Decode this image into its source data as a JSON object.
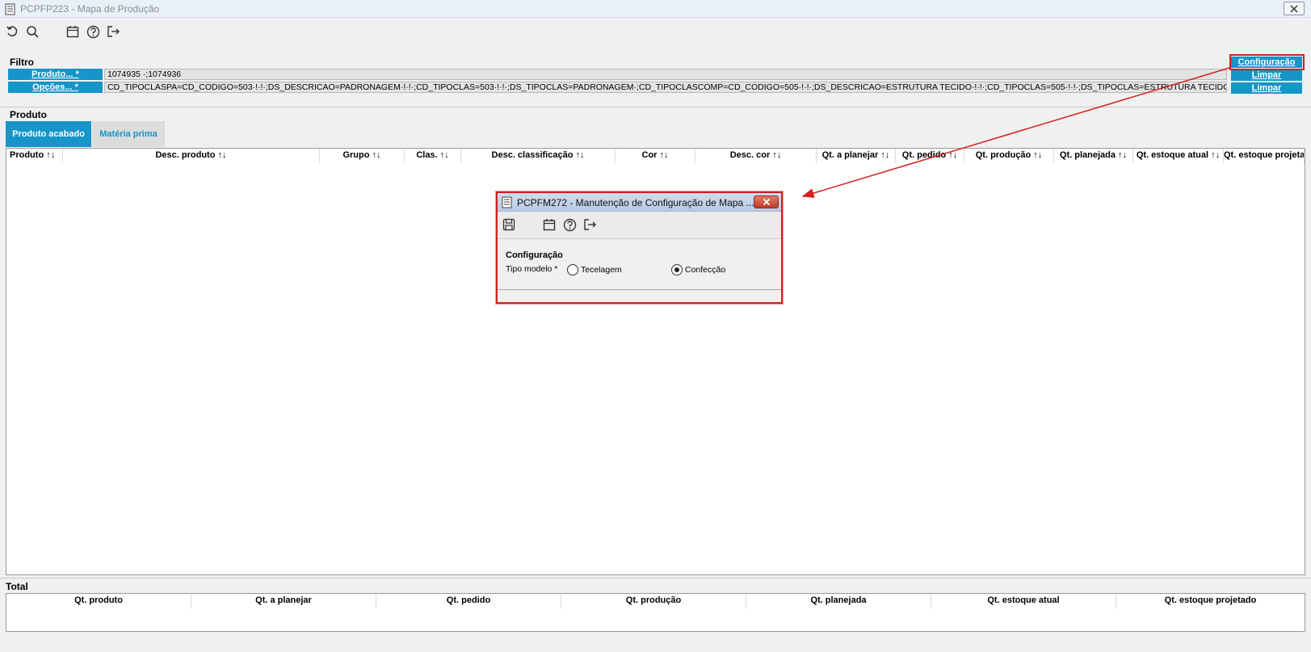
{
  "window": {
    "title": "PCPFP223 - Mapa de Produção"
  },
  "toolbar": {
    "icons": [
      "undo-icon",
      "search-icon",
      "calendar-icon",
      "help-icon",
      "exit-icon"
    ]
  },
  "filter": {
    "title": "Filtro",
    "produto_label": "Produto... *",
    "produto_value": "1074935 ·;1074936",
    "opcoes_label": "Opções... *",
    "opcoes_value": "CD_TIPOCLASPA=CD_CODIGO=503·!·!·;DS_DESCRICAO=PADRONAGEM·!·!·;CD_TIPOCLAS=503·!·!·;DS_TIPOCLAS=PADRONAGEM·;CD_TIPOCLASCOMP=CD_CODIGO=505·!·!·;DS_DESCRICAO=ESTRUTURA TECIDO·!·!·;CD_TIPOCLAS=505·!·!·;DS_TIPOCLAS=ESTRUTURA TECIDO·;CD_TIPOCLASCOMP",
    "config_button": "Configuração",
    "limpar1": "Limpar",
    "limpar2": "Limpar"
  },
  "produto": {
    "title": "Produto",
    "tabs": [
      "Produto acabado",
      "Matéria prima"
    ],
    "columns": [
      "Produto ↑↓",
      "Desc. produto ↑↓",
      "Grupo ↑↓",
      "Clas. ↑↓",
      "Desc. classificação ↑↓",
      "Cor ↑↓",
      "Desc. cor ↑↓",
      "Qt. a planejar ↑↓",
      "Qt. pedido ↑↓",
      "Qt. produção ↑↓",
      "Qt. planejada ↑↓",
      "Qt. estoque atual ↑↓",
      "Qt. estoque projetado ↑↓"
    ]
  },
  "total": {
    "title": "Total",
    "columns": [
      "Qt. produto",
      "Qt. a planejar",
      "Qt. pedido",
      "Qt. produção",
      "Qt. planejada",
      "Qt. estoque atual",
      "Qt. estoque projetado"
    ]
  },
  "dialog": {
    "title": "PCPFM272 - Manutenção de Configuração de Mapa ...",
    "section": "Configuração",
    "tipo_label": "Tipo modelo *",
    "options": [
      "Tecelagem",
      "Confecção"
    ],
    "selected": "Confecção"
  },
  "colors": {
    "accent": "#1595c8",
    "highlight": "#d41f1f"
  }
}
